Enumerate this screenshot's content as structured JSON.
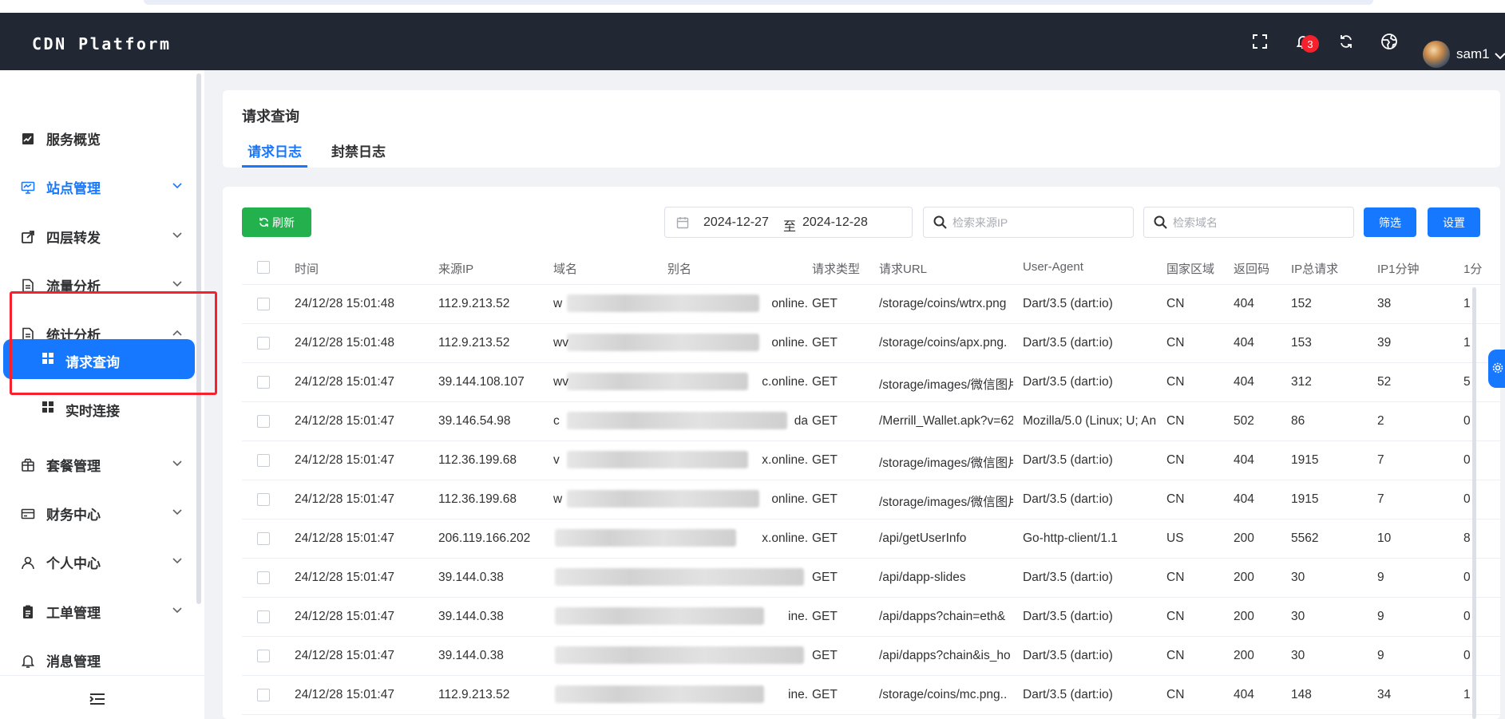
{
  "header": {
    "logo": "CDN Platform",
    "notification_count": "3",
    "username": "sam1"
  },
  "sidebar": {
    "items": [
      {
        "label": "服务概览",
        "icon": "chart-icon"
      },
      {
        "label": "站点管理",
        "icon": "monitor-icon"
      },
      {
        "label": "四层转发",
        "icon": "forward-icon"
      },
      {
        "label": "流量分析",
        "icon": "document-icon"
      },
      {
        "label": "统计分析",
        "icon": "document-icon"
      },
      {
        "label": "套餐管理",
        "icon": "package-icon"
      },
      {
        "label": "财务中心",
        "icon": "card-icon"
      },
      {
        "label": "个人中心",
        "icon": "user-icon"
      },
      {
        "label": "工单管理",
        "icon": "ticket-icon"
      },
      {
        "label": "消息管理",
        "icon": "bell-icon"
      }
    ],
    "subitems": [
      {
        "label": "请求查询"
      },
      {
        "label": "实时连接"
      }
    ]
  },
  "page": {
    "title": "请求查询",
    "tabs": [
      "请求日志",
      "封禁日志"
    ]
  },
  "toolbar": {
    "refresh_label": "刷新",
    "date_start": "2024-12-27",
    "date_sep": "至",
    "date_end": "2024-12-28",
    "ip_placeholder": "检索来源IP",
    "domain_placeholder": "检索域名",
    "filter_label": "筛选",
    "settings_label": "设置"
  },
  "table": {
    "columns": [
      "时间",
      "来源IP",
      "域名",
      "别名",
      "请求类型",
      "请求URL",
      "User-Agent",
      "国家区域",
      "返回码",
      "IP总请求",
      "IP1分钟",
      "1分"
    ],
    "rows": [
      {
        "time": "24/12/28 15:01:48",
        "ip": "112.9.213.52",
        "domain": "w",
        "alias": "online.",
        "method": "GET",
        "url": "/storage/coins/wtrx.png",
        "ua": "Dart/3.5 (dart:io)",
        "country": "CN",
        "code": "404",
        "total": "152",
        "min1": "38",
        "m": "1"
      },
      {
        "time": "24/12/28 15:01:48",
        "ip": "112.9.213.52",
        "domain": "wv",
        "alias": "online.",
        "method": "GET",
        "url": "/storage/coins/apx.png.",
        "ua": "Dart/3.5 (dart:io)",
        "country": "CN",
        "code": "404",
        "total": "153",
        "min1": "39",
        "m": "1"
      },
      {
        "time": "24/12/28 15:01:47",
        "ip": "39.144.108.107",
        "domain": "wv",
        "alias": "c.online.",
        "method": "GET",
        "url": "/storage/images/微信图片",
        "ua": "Dart/3.5 (dart:io)",
        "country": "CN",
        "code": "404",
        "total": "312",
        "min1": "52",
        "m": "5"
      },
      {
        "time": "24/12/28 15:01:47",
        "ip": "39.146.54.98",
        "domain": "c",
        "alias": "da",
        "method": "GET",
        "url": "/Merrill_Wallet.apk?v=62",
        "ua": "Mozilla/5.0 (Linux; U; An",
        "country": "CN",
        "code": "502",
        "total": "86",
        "min1": "2",
        "m": "0"
      },
      {
        "time": "24/12/28 15:01:47",
        "ip": "112.36.199.68",
        "domain": "v",
        "alias": "x.online.",
        "method": "GET",
        "url": "/storage/images/微信图片",
        "ua": "Dart/3.5 (dart:io)",
        "country": "CN",
        "code": "404",
        "total": "1915",
        "min1": "7",
        "m": "0"
      },
      {
        "time": "24/12/28 15:01:47",
        "ip": "112.36.199.68",
        "domain": "w",
        "alias": "online.",
        "method": "GET",
        "url": "/storage/images/微信图片",
        "ua": "Dart/3.5 (dart:io)",
        "country": "CN",
        "code": "404",
        "total": "1915",
        "min1": "7",
        "m": "0"
      },
      {
        "time": "24/12/28 15:01:47",
        "ip": "206.119.166.202",
        "domain": "",
        "alias": "x.online.",
        "method": "GET",
        "url": "/api/getUserInfo",
        "ua": "Go-http-client/1.1",
        "country": "US",
        "code": "200",
        "total": "5562",
        "min1": "10",
        "m": "8"
      },
      {
        "time": "24/12/28 15:01:47",
        "ip": "39.144.0.38",
        "domain": "",
        "alias": "",
        "method": "GET",
        "url": "/api/dapp-slides",
        "ua": "Dart/3.5 (dart:io)",
        "country": "CN",
        "code": "200",
        "total": "30",
        "min1": "9",
        "m": "0"
      },
      {
        "time": "24/12/28 15:01:47",
        "ip": "39.144.0.38",
        "domain": "",
        "alias": "ine.",
        "method": "GET",
        "url": "/api/dapps?chain=eth&",
        "ua": "Dart/3.5 (dart:io)",
        "country": "CN",
        "code": "200",
        "total": "30",
        "min1": "9",
        "m": "0"
      },
      {
        "time": "24/12/28 15:01:47",
        "ip": "39.144.0.38",
        "domain": "",
        "alias": "",
        "method": "GET",
        "url": "/api/dapps?chain&is_ho",
        "ua": "Dart/3.5 (dart:io)",
        "country": "CN",
        "code": "200",
        "total": "30",
        "min1": "9",
        "m": "0"
      },
      {
        "time": "24/12/28 15:01:47",
        "ip": "112.9.213.52",
        "domain": "",
        "alias": "ine.",
        "method": "GET",
        "url": "/storage/coins/mc.png..",
        "ua": "Dart/3.5 (dart:io)",
        "country": "CN",
        "code": "404",
        "total": "148",
        "min1": "34",
        "m": "1"
      }
    ]
  },
  "colors": {
    "accent": "#1677ff",
    "header_bg": "#222734",
    "refresh_green": "#22b14c",
    "highlight_red": "#f5222d"
  }
}
